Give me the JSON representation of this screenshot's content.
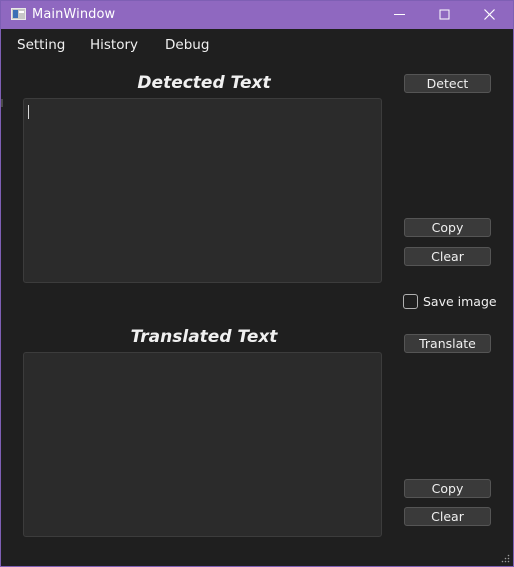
{
  "window": {
    "title": "MainWindow",
    "border_color": "#7e5fb4",
    "titlebar_color": "#8f68c0",
    "icons": [
      "app-icon",
      "minimize-icon",
      "maximize-icon",
      "close-icon",
      "resize-grip-icon"
    ]
  },
  "menu": {
    "items": [
      {
        "label": "Setting"
      },
      {
        "label": "History"
      },
      {
        "label": "Debug"
      }
    ]
  },
  "detected": {
    "heading": "Detected Text",
    "text": "",
    "detect_label": "Detect",
    "copy_label": "Copy",
    "clear_label": "Clear"
  },
  "options": {
    "save_image_label": "Save image",
    "save_image_checked": false
  },
  "translated": {
    "heading": "Translated Text",
    "text": "",
    "translate_label": "Translate",
    "copy_label": "Copy",
    "clear_label": "Clear"
  }
}
